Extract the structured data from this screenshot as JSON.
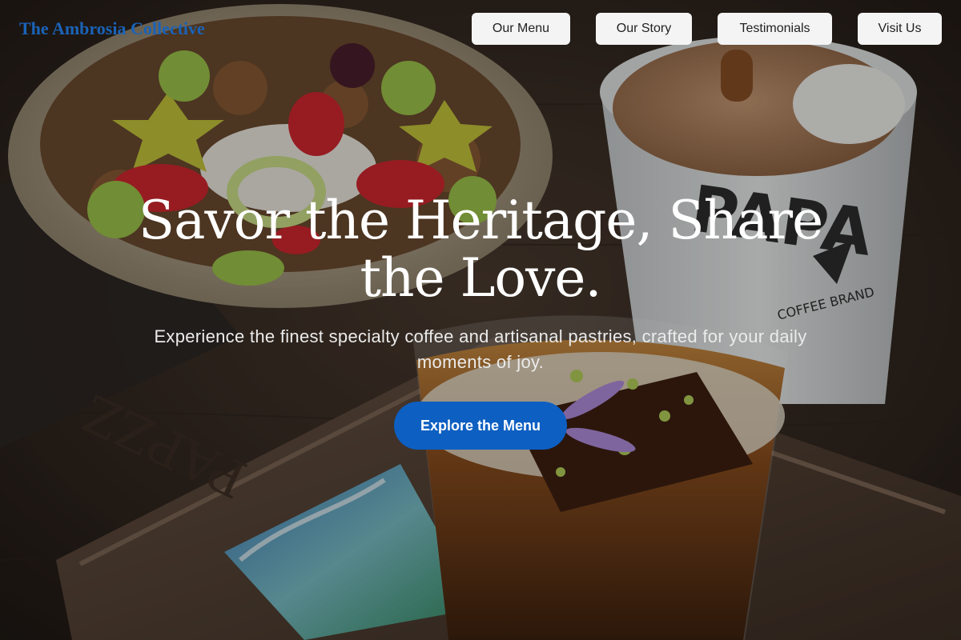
{
  "brand": {
    "name": "The Ambrosia Collective",
    "color": "#1a63b8"
  },
  "nav": {
    "items": [
      {
        "label": "Our Menu"
      },
      {
        "label": "Our Story"
      },
      {
        "label": "Testimonials"
      },
      {
        "label": "Visit Us"
      }
    ]
  },
  "hero": {
    "headline": "Savor the Heritage, Share the Love.",
    "subtitle": "Experience the finest specialty coffee and artisanal pastries, crafted for your daily moments of joy.",
    "cta_label": "Explore the Menu",
    "cta_color": "#0d5fc2",
    "cup_lettering": "PAPA",
    "cup_small_text": "COFFEE BRAND",
    "tray_lettering": "PAPZZ"
  }
}
